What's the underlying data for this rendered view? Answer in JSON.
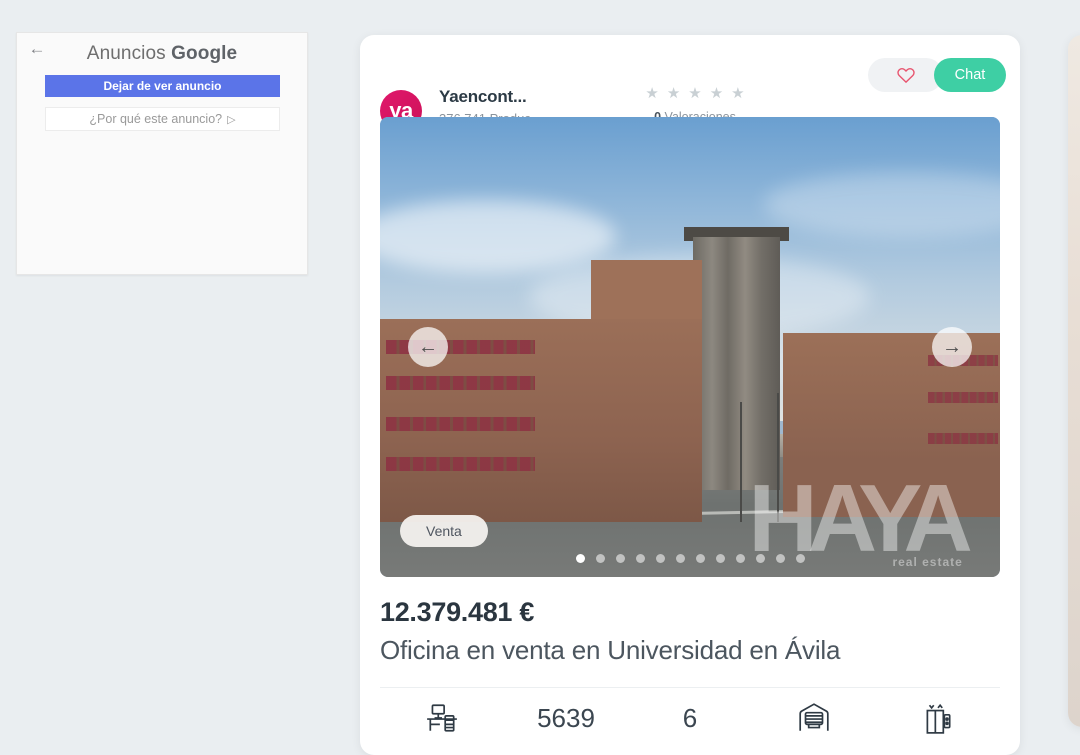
{
  "ad": {
    "back_icon": "back-arrow-icon",
    "title_prefix": "Anuncios",
    "title_brand": "Google",
    "stop_label": "Dejar de ver anuncio",
    "why_label": "¿Por qué este anuncio?",
    "adchoices_icon": "adchoices-icon",
    "accent": "#5b74e8"
  },
  "card": {
    "brand": {
      "logo_text": "ya",
      "logo_color": "#d81b60",
      "name": "Yaencont...",
      "subtitle": "376.741 Produc..."
    },
    "rating": {
      "stars": [
        "★",
        "★",
        "★",
        "★",
        "★"
      ],
      "count": "0",
      "count_label": "Valoraciones"
    },
    "actions": {
      "favorite_icon": "heart-icon",
      "favorite_color": "#e8556f",
      "chat_label": "Chat",
      "chat_color": "#3ecfa4"
    },
    "carousel": {
      "prev_icon": "arrow-left-icon",
      "next_icon": "arrow-right-icon",
      "badge_label": "Venta",
      "dot_count": 12,
      "active_dot": 0,
      "watermark_text": "HAYA",
      "watermark_sub": "real estate"
    },
    "price": "12.379.481 €",
    "title": "Oficina en venta en Universidad en Ávila",
    "features": [
      {
        "name": "office-desk-icon",
        "type": "icon",
        "value": ""
      },
      {
        "name": "surface-area",
        "type": "number",
        "value": "5639"
      },
      {
        "name": "rooms-count",
        "type": "number",
        "value": "6"
      },
      {
        "name": "garage-door-icon",
        "type": "icon",
        "value": ""
      },
      {
        "name": "elevator-icon",
        "type": "icon",
        "value": ""
      }
    ]
  }
}
